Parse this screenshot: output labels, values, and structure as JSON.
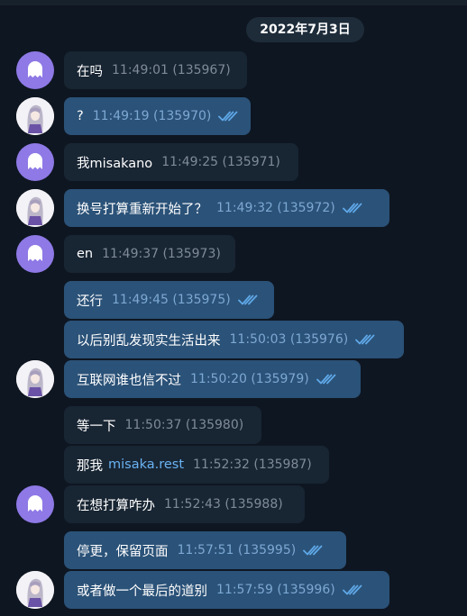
{
  "date_divider": "2022年7月3日",
  "messages": [
    {
      "text": "在吗",
      "time": "11:49:01 (135967)"
    },
    {
      "text": "?",
      "time": "11:49:19 (135970)"
    },
    {
      "text": "我misakano",
      "time": "11:49:25 (135971)"
    },
    {
      "text": "换号打算重新开始了？",
      "time": "11:49:32 (135972)"
    },
    {
      "text": "en",
      "time": "11:49:37 (135973)"
    },
    {
      "text": "还行",
      "time": "11:49:45 (135975)"
    },
    {
      "text": "以后别乱发现实生活出来",
      "time": "11:50:03 (135976)"
    },
    {
      "text": "互联网谁也信不过",
      "time": "11:50:20 (135979)"
    },
    {
      "text": "等一下",
      "time": "11:50:37 (135980)"
    },
    {
      "text": "那我",
      "link": "misaka.rest",
      "time": "11:52:32 (135987)"
    },
    {
      "text": "在想打算咋办",
      "time": "11:52:43 (135988)"
    },
    {
      "text": "停更，保留页面",
      "time": "11:57:51 (135995)"
    },
    {
      "text": "或者做一个最后的道别",
      "time": "11:57:59 (135996)"
    }
  ],
  "colors": {
    "background": "#0e1621",
    "incoming_bubble": "#182533",
    "outgoing_bubble": "#2b5278",
    "read_check": "#5fa8e8",
    "ghost_avatar": "#8e79e6"
  },
  "icons": {
    "incoming_avatar": "ghost-icon",
    "outgoing_avatar": "anime-girl-avatar",
    "read_receipt": "double-check-icon"
  }
}
